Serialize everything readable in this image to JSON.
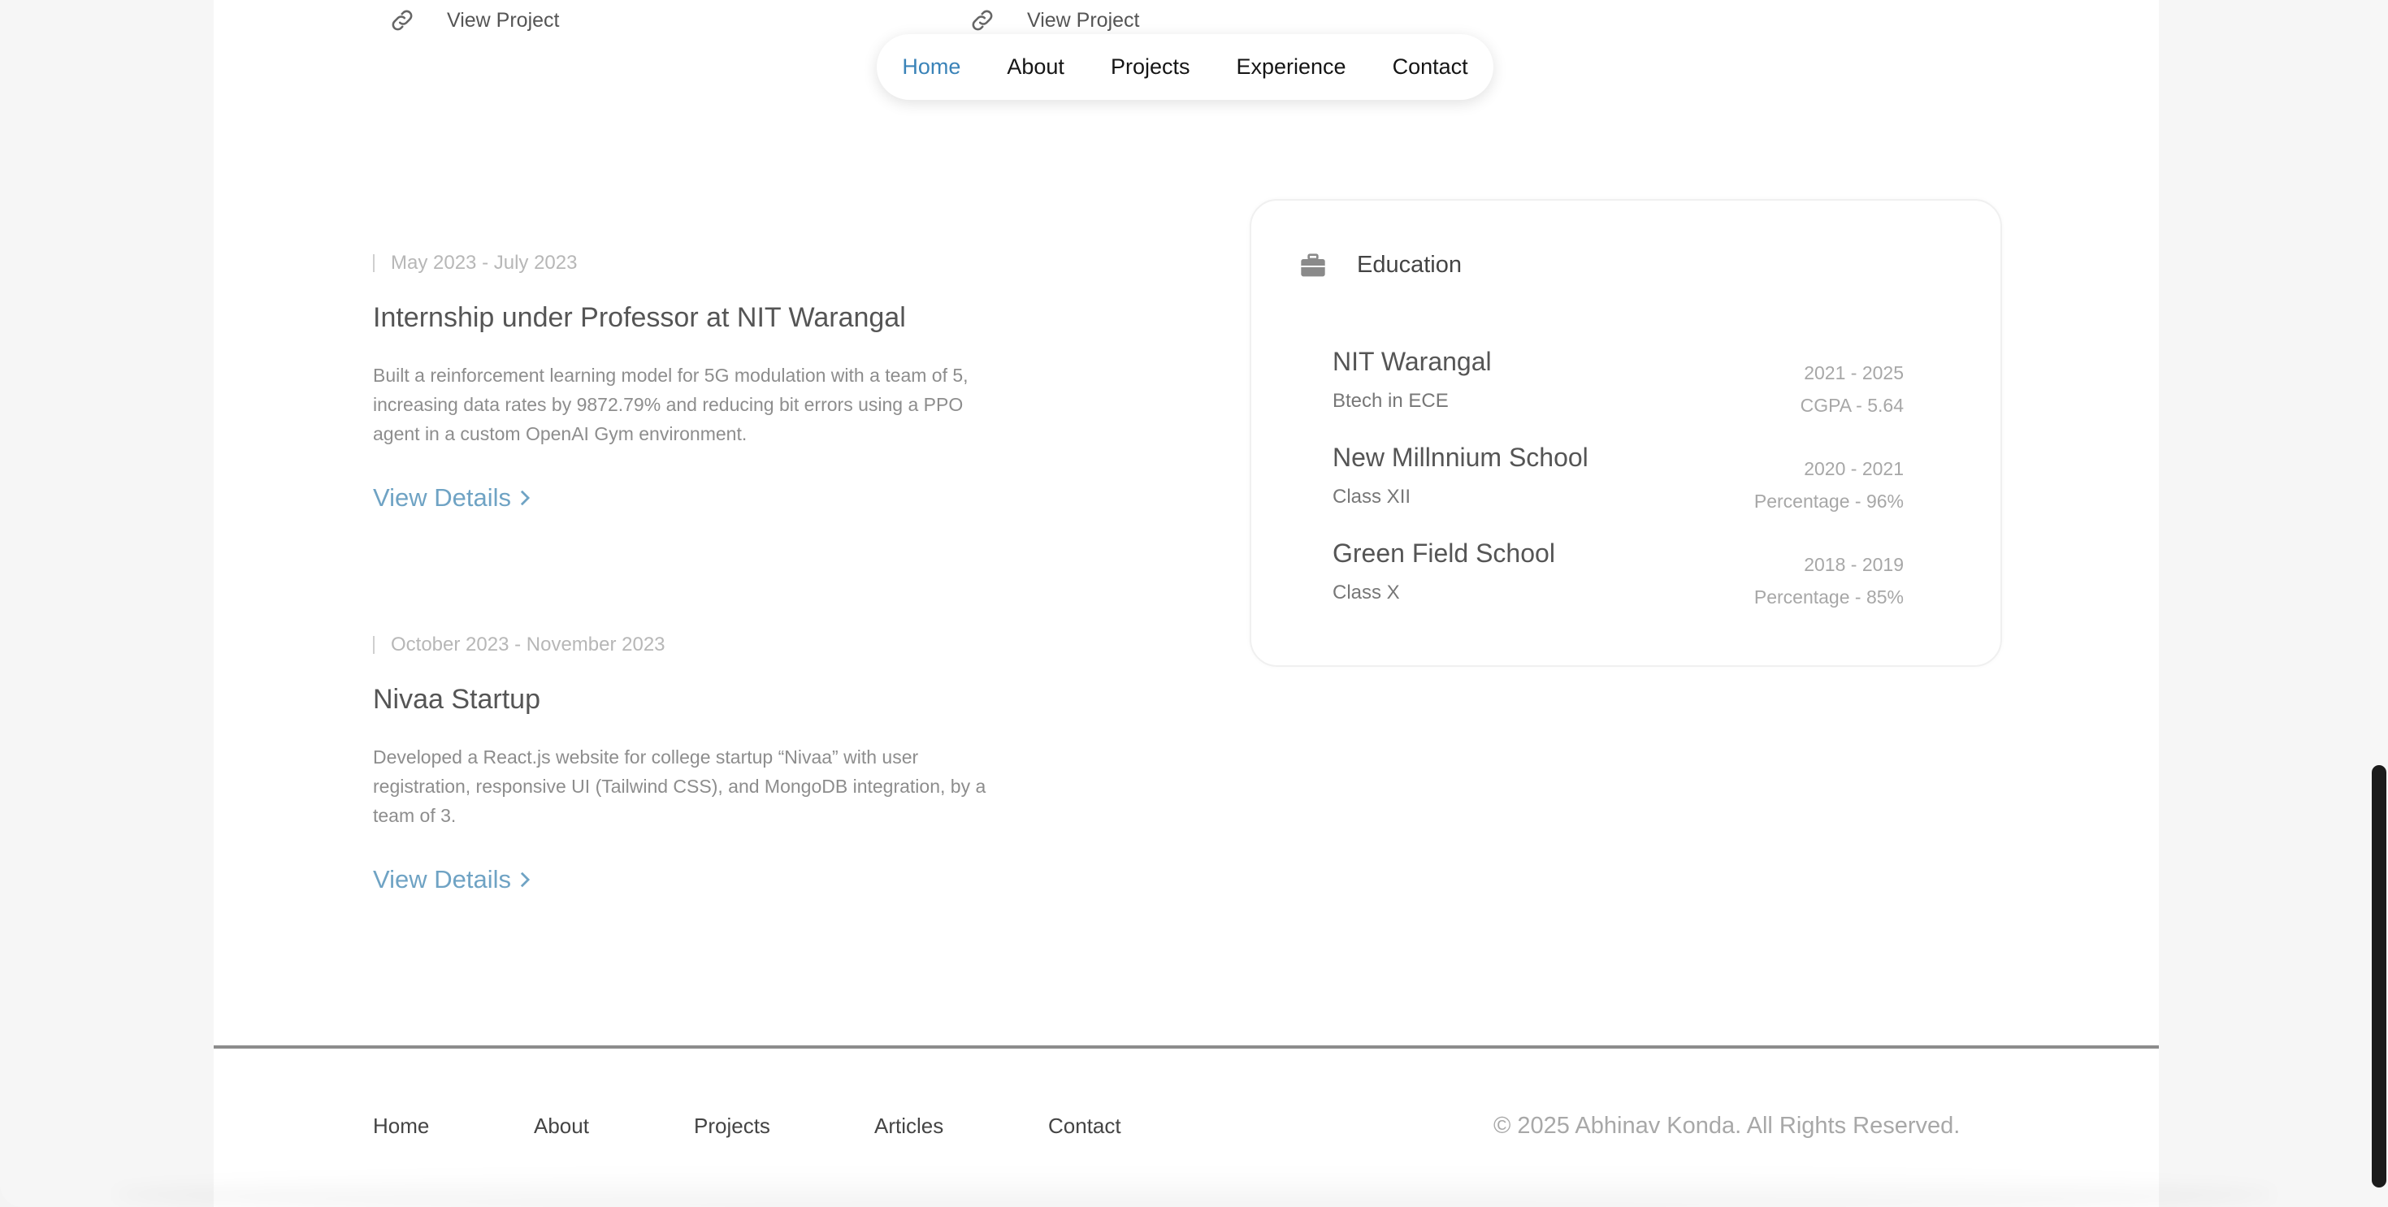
{
  "projects_partial": [
    {
      "label": "View Project"
    },
    {
      "label": "View Project"
    }
  ],
  "nav": {
    "items": [
      {
        "label": "Home",
        "active": true
      },
      {
        "label": "About"
      },
      {
        "label": "Projects"
      },
      {
        "label": "Experience"
      },
      {
        "label": "Contact"
      }
    ],
    "active_color": "#3a83b8"
  },
  "experience": [
    {
      "date": "May 2023 - July 2023",
      "title": "Internship under Professor at NIT Warangal",
      "description": "Built a reinforcement learning model for 5G modulation with a team of 5, increasing data rates by 9872.79% and reducing bit errors using a PPO agent in a custom OpenAI Gym environment.",
      "link": "View Details"
    },
    {
      "date": "October 2023 - November 2023",
      "title": "Nivaa Startup",
      "description": "Developed a React.js website for college startup “Nivaa” with user registration, responsive UI (Tailwind CSS), and MongoDB integration, by a team of 3.",
      "link": "View Details"
    }
  ],
  "education": {
    "title": "Education",
    "icon": "briefcase-icon",
    "entries": [
      {
        "school": "NIT Warangal",
        "degree": "Btech in ECE",
        "years": "2021 - 2025",
        "score": "CGPA - 5.64"
      },
      {
        "school": "New Millnnium School",
        "degree": "Class XII",
        "years": "2020 - 2021",
        "score": "Percentage - 96%"
      },
      {
        "school": "Green Field School",
        "degree": "Class X",
        "years": "2018 - 2019",
        "score": "Percentage - 85%"
      }
    ]
  },
  "footer": {
    "links": [
      "Home",
      "About",
      "Projects",
      "Articles",
      "Contact"
    ],
    "copyright": "© 2025 Abhinav Konda. All Rights Reserved."
  },
  "colors": {
    "link": "#6fa3c4",
    "nav_active": "#3a83b8"
  }
}
